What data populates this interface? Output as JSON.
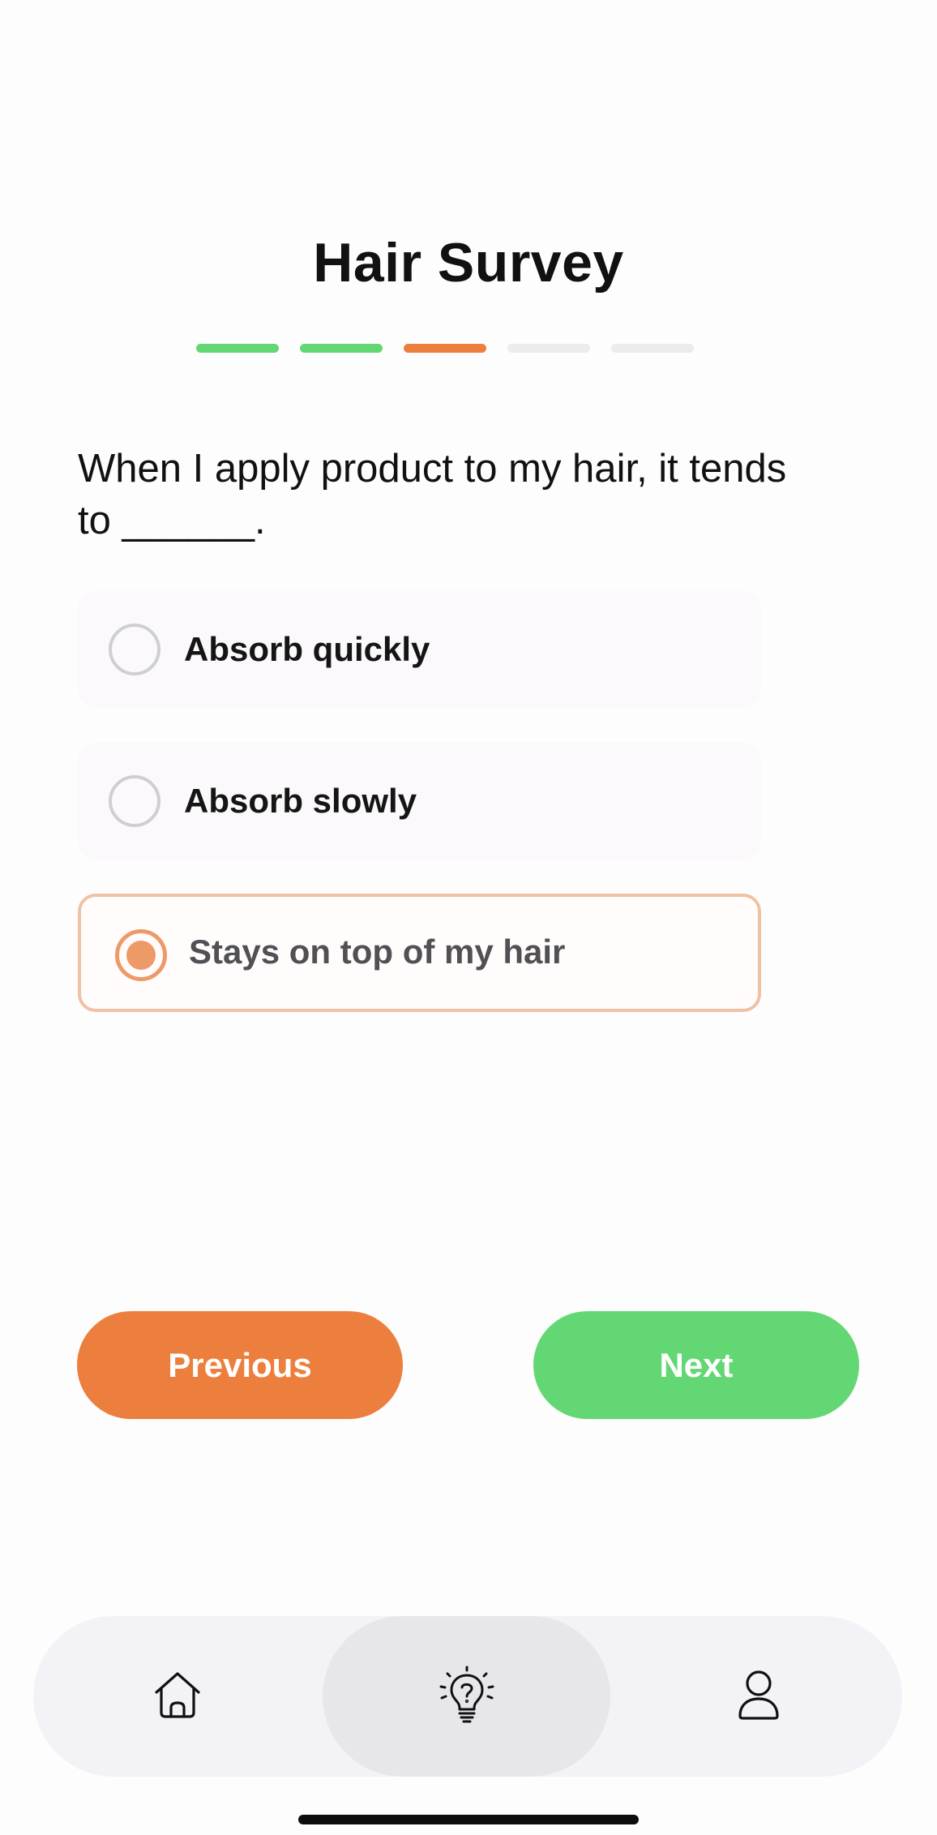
{
  "survey": {
    "title": "Hair Survey",
    "progress": {
      "total_steps": 5,
      "current_step": 3,
      "completed_color": "#64d775",
      "current_color": "#ed7f3e",
      "pending_color": "#ececec"
    },
    "question": "When I apply product to my hair, it tends to ______.",
    "options": [
      {
        "label": "Absorb quickly",
        "selected": false
      },
      {
        "label": "Absorb slowly",
        "selected": false
      },
      {
        "label": "Stays on top of my hair",
        "selected": true
      }
    ]
  },
  "buttons": {
    "previous_label": "Previous",
    "next_label": "Next",
    "previous_color": "#ed7f3e",
    "next_color": "#64d775"
  },
  "tabbar": {
    "tabs": [
      {
        "icon": "home-icon",
        "active": false
      },
      {
        "icon": "lightbulb-question-icon",
        "active": true
      },
      {
        "icon": "user-icon",
        "active": false
      }
    ]
  }
}
